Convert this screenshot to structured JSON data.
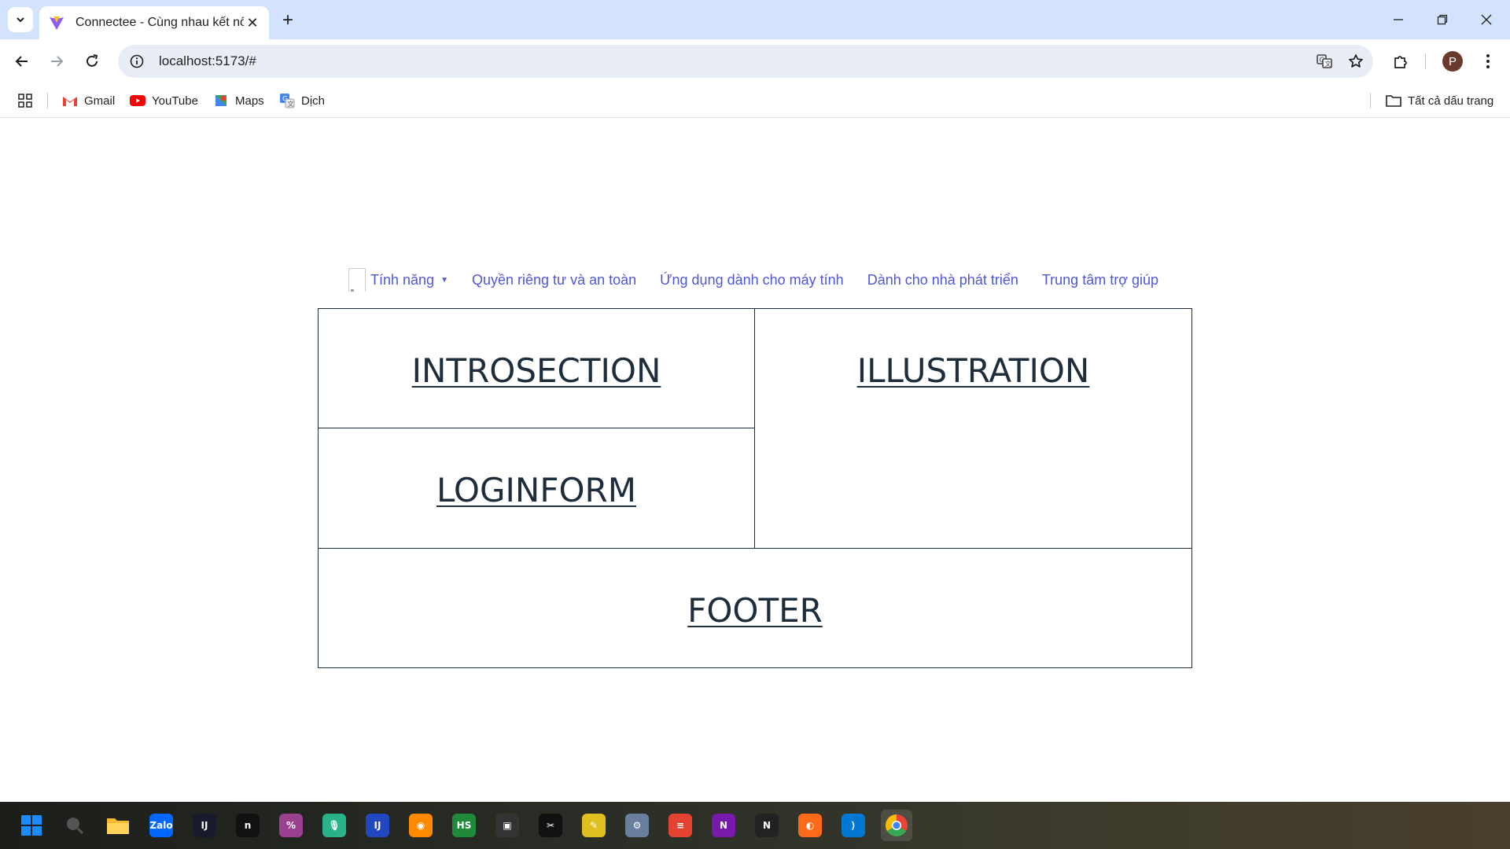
{
  "browser": {
    "tab": {
      "title": "Connectee - Cùng nhau kết nối",
      "close_glyph": "✕"
    },
    "new_tab_glyph": "+",
    "address": {
      "url": "localhost:5173/#"
    },
    "avatar_letter": "P",
    "bookmarks": {
      "items": [
        {
          "label": "Gmail",
          "icon": "gmail-icon"
        },
        {
          "label": "YouTube",
          "icon": "youtube-icon"
        },
        {
          "label": "Maps",
          "icon": "maps-icon"
        },
        {
          "label": "Dịch",
          "icon": "translate-icon"
        }
      ],
      "all_bookmarks": "Tất cả dấu trang"
    }
  },
  "site": {
    "nav": {
      "features": "Tính năng",
      "caret": "▼",
      "links": [
        "Quyền riêng tư và an toàn",
        "Ứng dụng dành cho máy tính",
        "Dành cho nhà phát triển",
        "Trung tâm trợ giúp"
      ]
    },
    "sections": {
      "intro": "INTROSECTION",
      "illustration": "ILLUSTRATION",
      "login": "LOGINFORM",
      "footer": "FOOTER"
    }
  },
  "taskbar": {
    "apps": [
      {
        "name": "start",
        "color": "#0a84ff",
        "label": ""
      },
      {
        "name": "search",
        "color": "#444444",
        "label": ""
      },
      {
        "name": "file-explorer",
        "color": "#f5b82e",
        "label": ""
      },
      {
        "name": "zalo",
        "color": "#0068ff",
        "label": "Zalo"
      },
      {
        "name": "intellij",
        "color": "#1a1a2e",
        "label": "IJ"
      },
      {
        "name": "app-n",
        "color": "#111111",
        "label": "n"
      },
      {
        "name": "app-purple",
        "color": "#9b3f8f",
        "label": "%"
      },
      {
        "name": "app-mic",
        "color": "#29b38a",
        "label": "🎙"
      },
      {
        "name": "app-blue",
        "color": "#2148c0",
        "label": "IJ"
      },
      {
        "name": "app-orange",
        "color": "#ff8a00",
        "label": "◉"
      },
      {
        "name": "app-hs",
        "color": "#1f8a3a",
        "label": "HS"
      },
      {
        "name": "app-box",
        "color": "#333333",
        "label": "▣"
      },
      {
        "name": "capcut",
        "color": "#111111",
        "label": "✂"
      },
      {
        "name": "app-yellow",
        "color": "#e0c020",
        "label": "✎"
      },
      {
        "name": "app-gear",
        "color": "#6a7fa0",
        "label": "⚙"
      },
      {
        "name": "todoist",
        "color": "#e44332",
        "label": "≡"
      },
      {
        "name": "onenote",
        "color": "#7719aa",
        "label": "N"
      },
      {
        "name": "notion",
        "color": "#222222",
        "label": "N"
      },
      {
        "name": "firefox",
        "color": "#ff6a1a",
        "label": "◐"
      },
      {
        "name": "vscode",
        "color": "#0078d4",
        "label": "⟩"
      },
      {
        "name": "chrome",
        "color": "#4285f4",
        "label": "◎"
      }
    ]
  }
}
